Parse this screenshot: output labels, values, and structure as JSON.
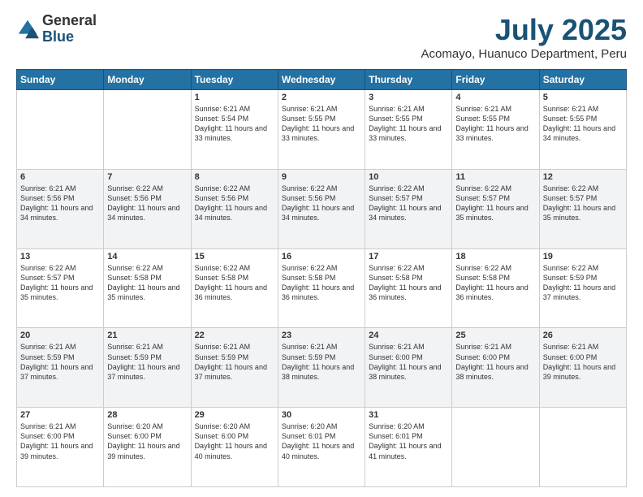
{
  "logo": {
    "general": "General",
    "blue": "Blue"
  },
  "header": {
    "month": "July 2025",
    "location": "Acomayo, Huanuco Department, Peru"
  },
  "days_of_week": [
    "Sunday",
    "Monday",
    "Tuesday",
    "Wednesday",
    "Thursday",
    "Friday",
    "Saturday"
  ],
  "weeks": [
    [
      {
        "day": "",
        "detail": ""
      },
      {
        "day": "",
        "detail": ""
      },
      {
        "day": "1",
        "detail": "Sunrise: 6:21 AM\nSunset: 5:54 PM\nDaylight: 11 hours and 33 minutes."
      },
      {
        "day": "2",
        "detail": "Sunrise: 6:21 AM\nSunset: 5:55 PM\nDaylight: 11 hours and 33 minutes."
      },
      {
        "day": "3",
        "detail": "Sunrise: 6:21 AM\nSunset: 5:55 PM\nDaylight: 11 hours and 33 minutes."
      },
      {
        "day": "4",
        "detail": "Sunrise: 6:21 AM\nSunset: 5:55 PM\nDaylight: 11 hours and 33 minutes."
      },
      {
        "day": "5",
        "detail": "Sunrise: 6:21 AM\nSunset: 5:55 PM\nDaylight: 11 hours and 34 minutes."
      }
    ],
    [
      {
        "day": "6",
        "detail": "Sunrise: 6:21 AM\nSunset: 5:56 PM\nDaylight: 11 hours and 34 minutes."
      },
      {
        "day": "7",
        "detail": "Sunrise: 6:22 AM\nSunset: 5:56 PM\nDaylight: 11 hours and 34 minutes."
      },
      {
        "day": "8",
        "detail": "Sunrise: 6:22 AM\nSunset: 5:56 PM\nDaylight: 11 hours and 34 minutes."
      },
      {
        "day": "9",
        "detail": "Sunrise: 6:22 AM\nSunset: 5:56 PM\nDaylight: 11 hours and 34 minutes."
      },
      {
        "day": "10",
        "detail": "Sunrise: 6:22 AM\nSunset: 5:57 PM\nDaylight: 11 hours and 34 minutes."
      },
      {
        "day": "11",
        "detail": "Sunrise: 6:22 AM\nSunset: 5:57 PM\nDaylight: 11 hours and 35 minutes."
      },
      {
        "day": "12",
        "detail": "Sunrise: 6:22 AM\nSunset: 5:57 PM\nDaylight: 11 hours and 35 minutes."
      }
    ],
    [
      {
        "day": "13",
        "detail": "Sunrise: 6:22 AM\nSunset: 5:57 PM\nDaylight: 11 hours and 35 minutes."
      },
      {
        "day": "14",
        "detail": "Sunrise: 6:22 AM\nSunset: 5:58 PM\nDaylight: 11 hours and 35 minutes."
      },
      {
        "day": "15",
        "detail": "Sunrise: 6:22 AM\nSunset: 5:58 PM\nDaylight: 11 hours and 36 minutes."
      },
      {
        "day": "16",
        "detail": "Sunrise: 6:22 AM\nSunset: 5:58 PM\nDaylight: 11 hours and 36 minutes."
      },
      {
        "day": "17",
        "detail": "Sunrise: 6:22 AM\nSunset: 5:58 PM\nDaylight: 11 hours and 36 minutes."
      },
      {
        "day": "18",
        "detail": "Sunrise: 6:22 AM\nSunset: 5:58 PM\nDaylight: 11 hours and 36 minutes."
      },
      {
        "day": "19",
        "detail": "Sunrise: 6:22 AM\nSunset: 5:59 PM\nDaylight: 11 hours and 37 minutes."
      }
    ],
    [
      {
        "day": "20",
        "detail": "Sunrise: 6:21 AM\nSunset: 5:59 PM\nDaylight: 11 hours and 37 minutes."
      },
      {
        "day": "21",
        "detail": "Sunrise: 6:21 AM\nSunset: 5:59 PM\nDaylight: 11 hours and 37 minutes."
      },
      {
        "day": "22",
        "detail": "Sunrise: 6:21 AM\nSunset: 5:59 PM\nDaylight: 11 hours and 37 minutes."
      },
      {
        "day": "23",
        "detail": "Sunrise: 6:21 AM\nSunset: 5:59 PM\nDaylight: 11 hours and 38 minutes."
      },
      {
        "day": "24",
        "detail": "Sunrise: 6:21 AM\nSunset: 6:00 PM\nDaylight: 11 hours and 38 minutes."
      },
      {
        "day": "25",
        "detail": "Sunrise: 6:21 AM\nSunset: 6:00 PM\nDaylight: 11 hours and 38 minutes."
      },
      {
        "day": "26",
        "detail": "Sunrise: 6:21 AM\nSunset: 6:00 PM\nDaylight: 11 hours and 39 minutes."
      }
    ],
    [
      {
        "day": "27",
        "detail": "Sunrise: 6:21 AM\nSunset: 6:00 PM\nDaylight: 11 hours and 39 minutes."
      },
      {
        "day": "28",
        "detail": "Sunrise: 6:20 AM\nSunset: 6:00 PM\nDaylight: 11 hours and 39 minutes."
      },
      {
        "day": "29",
        "detail": "Sunrise: 6:20 AM\nSunset: 6:00 PM\nDaylight: 11 hours and 40 minutes."
      },
      {
        "day": "30",
        "detail": "Sunrise: 6:20 AM\nSunset: 6:01 PM\nDaylight: 11 hours and 40 minutes."
      },
      {
        "day": "31",
        "detail": "Sunrise: 6:20 AM\nSunset: 6:01 PM\nDaylight: 11 hours and 41 minutes."
      },
      {
        "day": "",
        "detail": ""
      },
      {
        "day": "",
        "detail": ""
      }
    ]
  ]
}
